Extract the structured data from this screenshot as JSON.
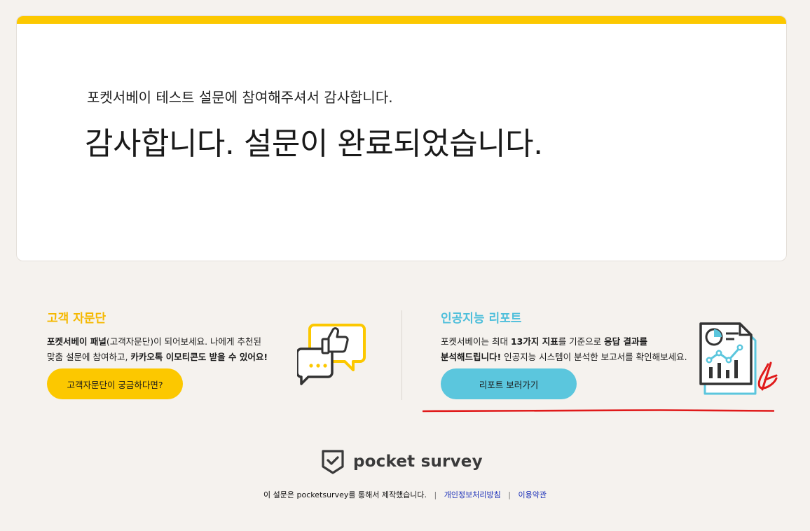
{
  "colors": {
    "accent_yellow": "#fcc800",
    "accent_blue": "#5bc6dd",
    "heading_blue": "#4fbfdb",
    "link_blue": "#1a2fb8",
    "annotation_red": "#e01a1a",
    "background": "#f5f2ee"
  },
  "completion_card": {
    "subtitle": "포켓서베이 테스트 설문에 참여해주셔서 감사합니다.",
    "title": "감사합니다. 설문이 완료되었습니다."
  },
  "panel_promo": {
    "heading": "고객 자문단",
    "line1_bold": "포켓서베이 패널",
    "line1_rest": "(고객자문단)이 되어보세요. 나에게 추천된",
    "line2_start": "맞춤 설문에 참여하고, ",
    "line2_bold": "카카오톡 이모티콘도 받을 수 있어요!",
    "button_label": "고객자문단이 궁금하다면?",
    "icon": "chat-thumbs-up-icon"
  },
  "report_promo": {
    "heading": "인공지능 리포트",
    "line1_start": "포켓서베이는 최대 ",
    "line1_bold1": "13가지 지표",
    "line1_mid": "를 기준으로 ",
    "line1_bold2": "응답 결과를",
    "line2_bold": "분석해드립니다!",
    "line2_rest": " 인공지능 시스템이 분석한 보고서를 확인해보세요.",
    "button_label": "리포트 보러가기",
    "icon": "report-chart-icon"
  },
  "logo": {
    "text": "pocket survey",
    "icon": "pocket-shield-check-icon"
  },
  "footer": {
    "made_with": "이 설문은 pocketsurvey를 통해서 제작했습니다.",
    "separator": "|",
    "privacy_link": "개인정보처리방침",
    "terms_link": "이용약관"
  }
}
